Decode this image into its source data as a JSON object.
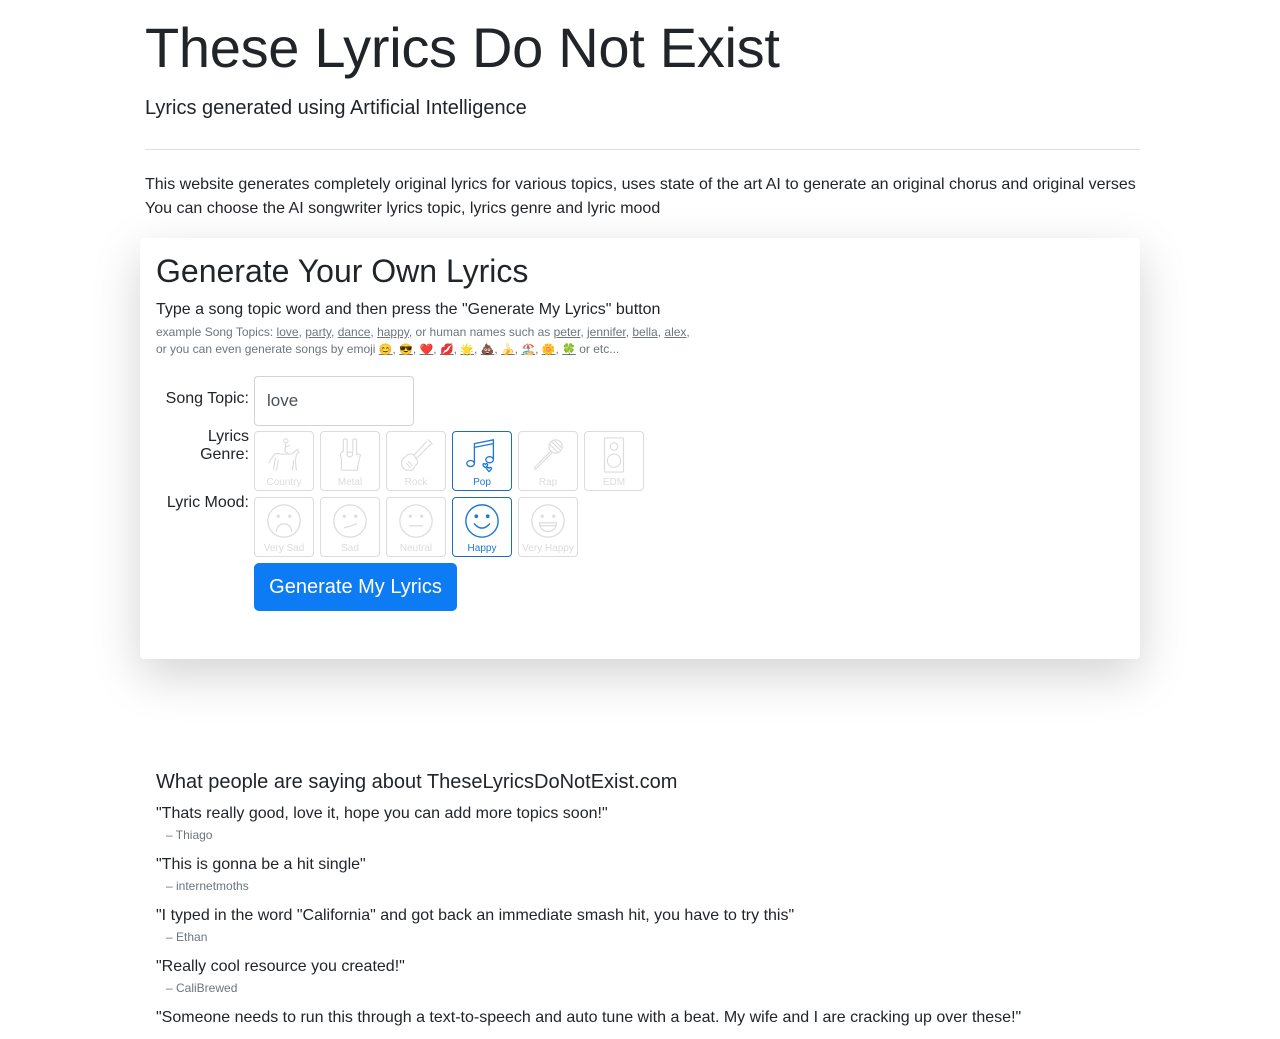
{
  "header": {
    "title": "These Lyrics Do Not Exist",
    "subtitle": "Lyrics generated using Artificial Intelligence"
  },
  "intro": {
    "line1": "This website generates completely original lyrics for various topics, uses state of the art AI to generate an original chorus and original verses",
    "line2": "You can choose the AI songwriter lyrics topic, lyrics genre and lyric mood"
  },
  "generator": {
    "title": "Generate Your Own Lyrics",
    "lead": "Type a song topic word and then press the \"Generate My Lyrics\" button",
    "examples_prefix": "example Song Topics:",
    "topic_links": [
      "love",
      "party",
      "dance",
      "happy"
    ],
    "names_prefix": ", or human names such as",
    "name_links": [
      "peter",
      "jennifer",
      "bella",
      "alex"
    ],
    "emoji_prefix": "or you can even generate songs by emoji",
    "emoji_links": [
      "😊",
      "😎",
      "❤️",
      "💋",
      "🌟",
      "💩",
      "🍌",
      "🏖️",
      "🌼",
      "🍀"
    ],
    "emoji_suffix": "or etc...",
    "topic_label": "Song Topic:",
    "topic_value": "love",
    "genre_label": "Lyrics Genre:",
    "genres": [
      {
        "label": "Country",
        "icon": "horse-rider-icon",
        "selected": false
      },
      {
        "label": "Metal",
        "icon": "rock-hand-icon",
        "selected": false
      },
      {
        "label": "Rock",
        "icon": "guitar-icon",
        "selected": false
      },
      {
        "label": "Pop",
        "icon": "music-notes-icon",
        "selected": true
      },
      {
        "label": "Rap",
        "icon": "microphone-icon",
        "selected": false
      },
      {
        "label": "EDM",
        "icon": "speaker-icon",
        "selected": false
      }
    ],
    "mood_label": "Lyric Mood:",
    "moods": [
      {
        "label": "Very Sad",
        "icon": "very-sad-face-icon",
        "selected": false
      },
      {
        "label": "Sad",
        "icon": "sad-face-icon",
        "selected": false
      },
      {
        "label": "Neutral",
        "icon": "neutral-face-icon",
        "selected": false
      },
      {
        "label": "Happy",
        "icon": "happy-face-icon",
        "selected": true
      },
      {
        "label": "Very Happy",
        "icon": "very-happy-face-icon",
        "selected": false
      }
    ],
    "button_label": "Generate My Lyrics"
  },
  "testimonials": {
    "heading": "What people are saying about TheseLyricsDoNotExist.com",
    "items": [
      {
        "quote": "\"Thats really good, love it, hope you can add more topics soon!\"",
        "author": "– Thiago"
      },
      {
        "quote": "\"This is gonna be a hit single\"",
        "author": "– internetmoths"
      },
      {
        "quote": "\"I typed in the word \"California\" and got back an immediate smash hit, you have to try this\"",
        "author": "– Ethan"
      },
      {
        "quote": "\"Really cool resource you created!\"",
        "author": "– CaliBrewed"
      },
      {
        "quote": "\"Someone needs to run this through a text-to-speech and auto tune with a beat. My wife and I are cracking up over these!\"",
        "author": ""
      }
    ]
  }
}
